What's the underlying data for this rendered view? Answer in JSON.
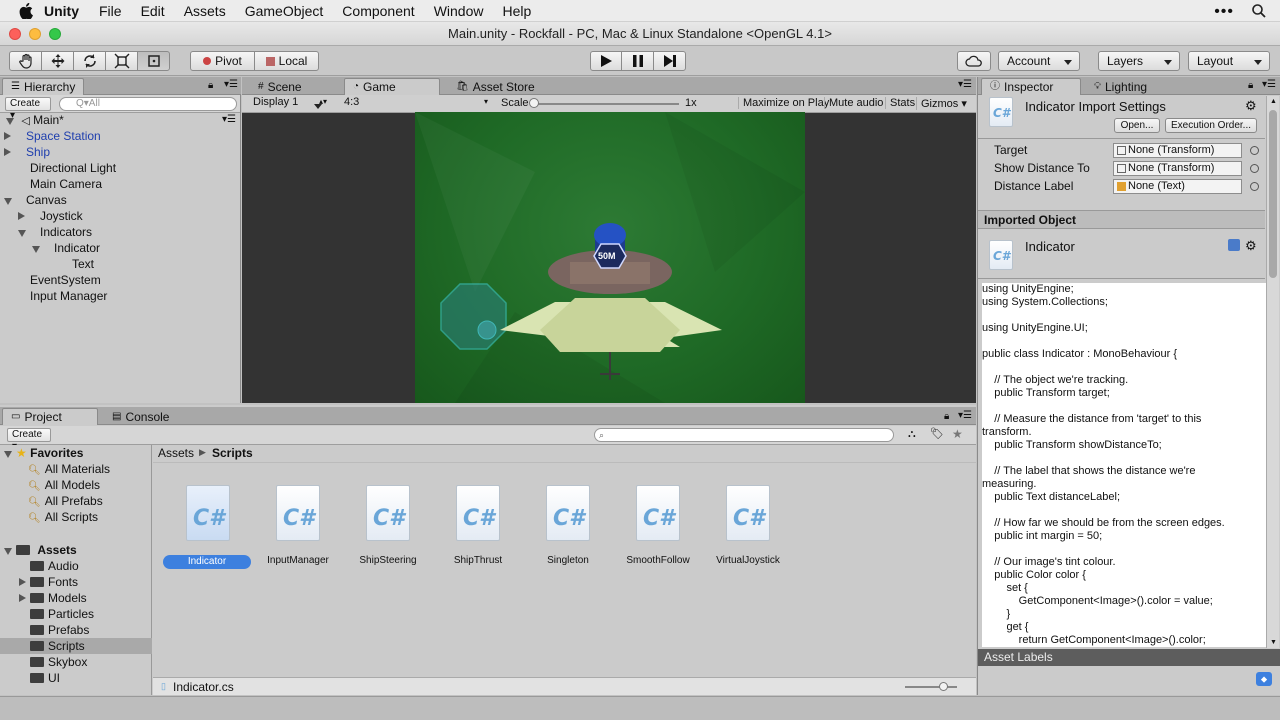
{
  "menubar": {
    "app": "Unity",
    "items": [
      "File",
      "Edit",
      "Assets",
      "GameObject",
      "Component",
      "Window",
      "Help"
    ]
  },
  "window": {
    "title": "Main.unity - Rockfall - PC, Mac & Linux Standalone <OpenGL 4.1>"
  },
  "toolbar": {
    "pivot": "Pivot",
    "local": "Local",
    "account": "Account",
    "layers": "Layers",
    "layout": "Layout"
  },
  "hierarchy": {
    "tab": "Hierarchy",
    "create": "Create",
    "search_placeholder": "Q▾All",
    "scene": "Main*",
    "items": [
      {
        "label": "Space Station",
        "indent": 0,
        "arrow": "r",
        "prefab": true
      },
      {
        "label": "Ship",
        "indent": 0,
        "arrow": "r",
        "prefab": true
      },
      {
        "label": "Directional Light",
        "indent": 0,
        "arrow": "",
        "prefab": false
      },
      {
        "label": "Main Camera",
        "indent": 0,
        "arrow": "",
        "prefab": false
      },
      {
        "label": "Canvas",
        "indent": 0,
        "arrow": "d",
        "prefab": false
      },
      {
        "label": "Joystick",
        "indent": 1,
        "arrow": "r",
        "prefab": false
      },
      {
        "label": "Indicators",
        "indent": 1,
        "arrow": "d",
        "prefab": false
      },
      {
        "label": "Indicator",
        "indent": 2,
        "arrow": "d",
        "prefab": false
      },
      {
        "label": "Text",
        "indent": 3,
        "arrow": "",
        "prefab": false
      },
      {
        "label": "EventSystem",
        "indent": 0,
        "arrow": "",
        "prefab": false
      },
      {
        "label": "Input Manager",
        "indent": 0,
        "arrow": "",
        "prefab": false
      }
    ]
  },
  "center_tabs": {
    "scene": "Scene",
    "game": "Game",
    "store": "Asset Store"
  },
  "game_bar": {
    "display": "Display 1",
    "aspect": "4:3",
    "scale": "Scale",
    "scale_value": "1x",
    "maximize": "Maximize on Play",
    "mute": "Mute audio",
    "stats": "Stats",
    "gizmos": "Gizmos"
  },
  "game_view": {
    "distance_label": "50M"
  },
  "project": {
    "tab": "Project",
    "console_tab": "Console",
    "create": "Create",
    "favorites": "Favorites",
    "fav_items": [
      "All Materials",
      "All Models",
      "All Prefabs",
      "All Scripts"
    ],
    "assets": "Assets",
    "asset_folders": [
      {
        "label": "Audio",
        "arrow": ""
      },
      {
        "label": "Fonts",
        "arrow": "r"
      },
      {
        "label": "Models",
        "arrow": "r"
      },
      {
        "label": "Particles",
        "arrow": ""
      },
      {
        "label": "Prefabs",
        "arrow": ""
      },
      {
        "label": "Scripts",
        "arrow": "",
        "selected": true
      },
      {
        "label": "Skybox",
        "arrow": ""
      },
      {
        "label": "UI",
        "arrow": ""
      }
    ],
    "breadcrumb": [
      "Assets",
      "Scripts"
    ],
    "files": [
      "Indicator",
      "InputManager",
      "ShipSteering",
      "ShipThrust",
      "Singleton",
      "SmoothFollow",
      "VirtualJoystick"
    ],
    "selected_file_path": "Indicator.cs"
  },
  "inspector": {
    "tab": "Inspector",
    "lighting_tab": "Lighting",
    "title": "Indicator Import Settings",
    "open": "Open...",
    "exec_order": "Execution Order...",
    "fields": [
      {
        "label": "Target",
        "value": "None (Transform)"
      },
      {
        "label": "Show Distance To",
        "value": "None (Transform)"
      },
      {
        "label": "Distance Label",
        "value": "None (Text)"
      }
    ],
    "imported_object": "Imported Object",
    "object_name": "Indicator",
    "code": "using UnityEngine;\nusing System.Collections;\n\nusing UnityEngine.UI;\n\npublic class Indicator : MonoBehaviour {\n\n    // The object we're tracking.\n    public Transform target;\n\n    // Measure the distance from 'target' to this\ntransform.\n    public Transform showDistanceTo;\n\n    // The label that shows the distance we're\nmeasuring.\n    public Text distanceLabel;\n\n    // How far we should be from the screen edges.\n    public int margin = 50;\n\n    // Our image's tint colour.\n    public Color color {\n        set {\n            GetComponent<Image>().color = value;\n        }\n        get {\n            return GetComponent<Image>().color;",
    "asset_labels": "Asset Labels"
  },
  "colors": {
    "selection": "#3d80df",
    "prefab_text": "#1f3fae",
    "game_bg": "#1f6a26"
  }
}
